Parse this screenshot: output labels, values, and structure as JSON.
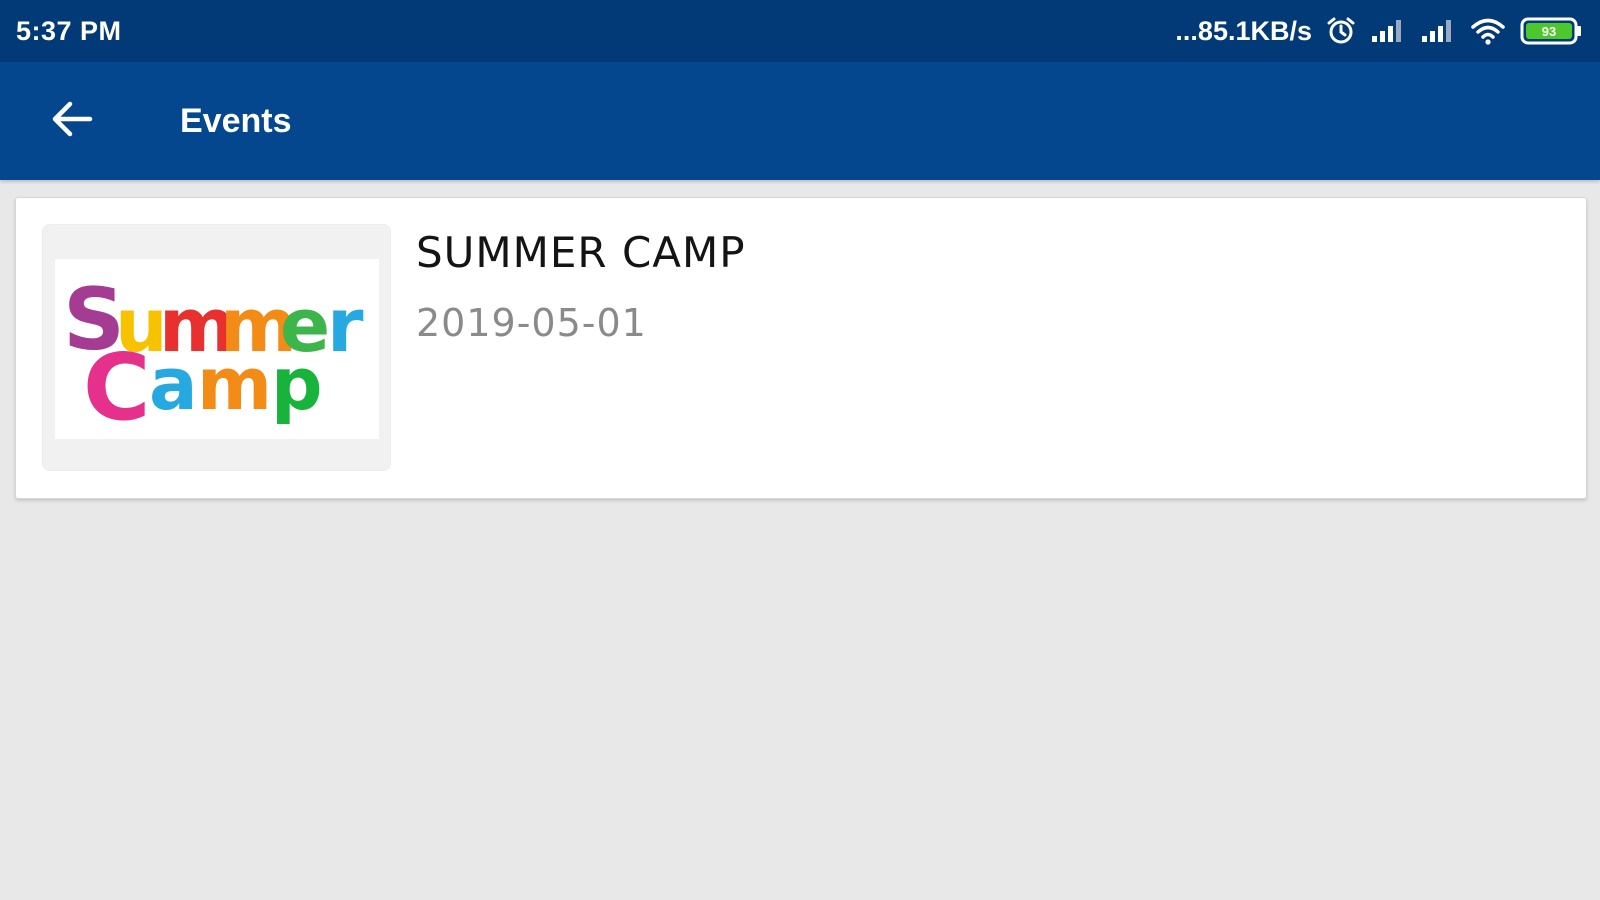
{
  "status_bar": {
    "time": "5:37 PM",
    "network_speed": "...85.1KB/s",
    "battery_level": "93",
    "battery_color": "#4cc72c",
    "icons": [
      "alarm-icon",
      "signal-icon",
      "signal-icon",
      "wifi-icon",
      "battery-icon"
    ]
  },
  "app_bar": {
    "back_icon": "arrow-left-icon",
    "title": "Events",
    "color": "#04478f"
  },
  "events": [
    {
      "title": "SUMMER CAMP",
      "date": "2019-05-01",
      "image": {
        "logo_line1": "Summer",
        "logo_line2": "Camp"
      }
    }
  ]
}
